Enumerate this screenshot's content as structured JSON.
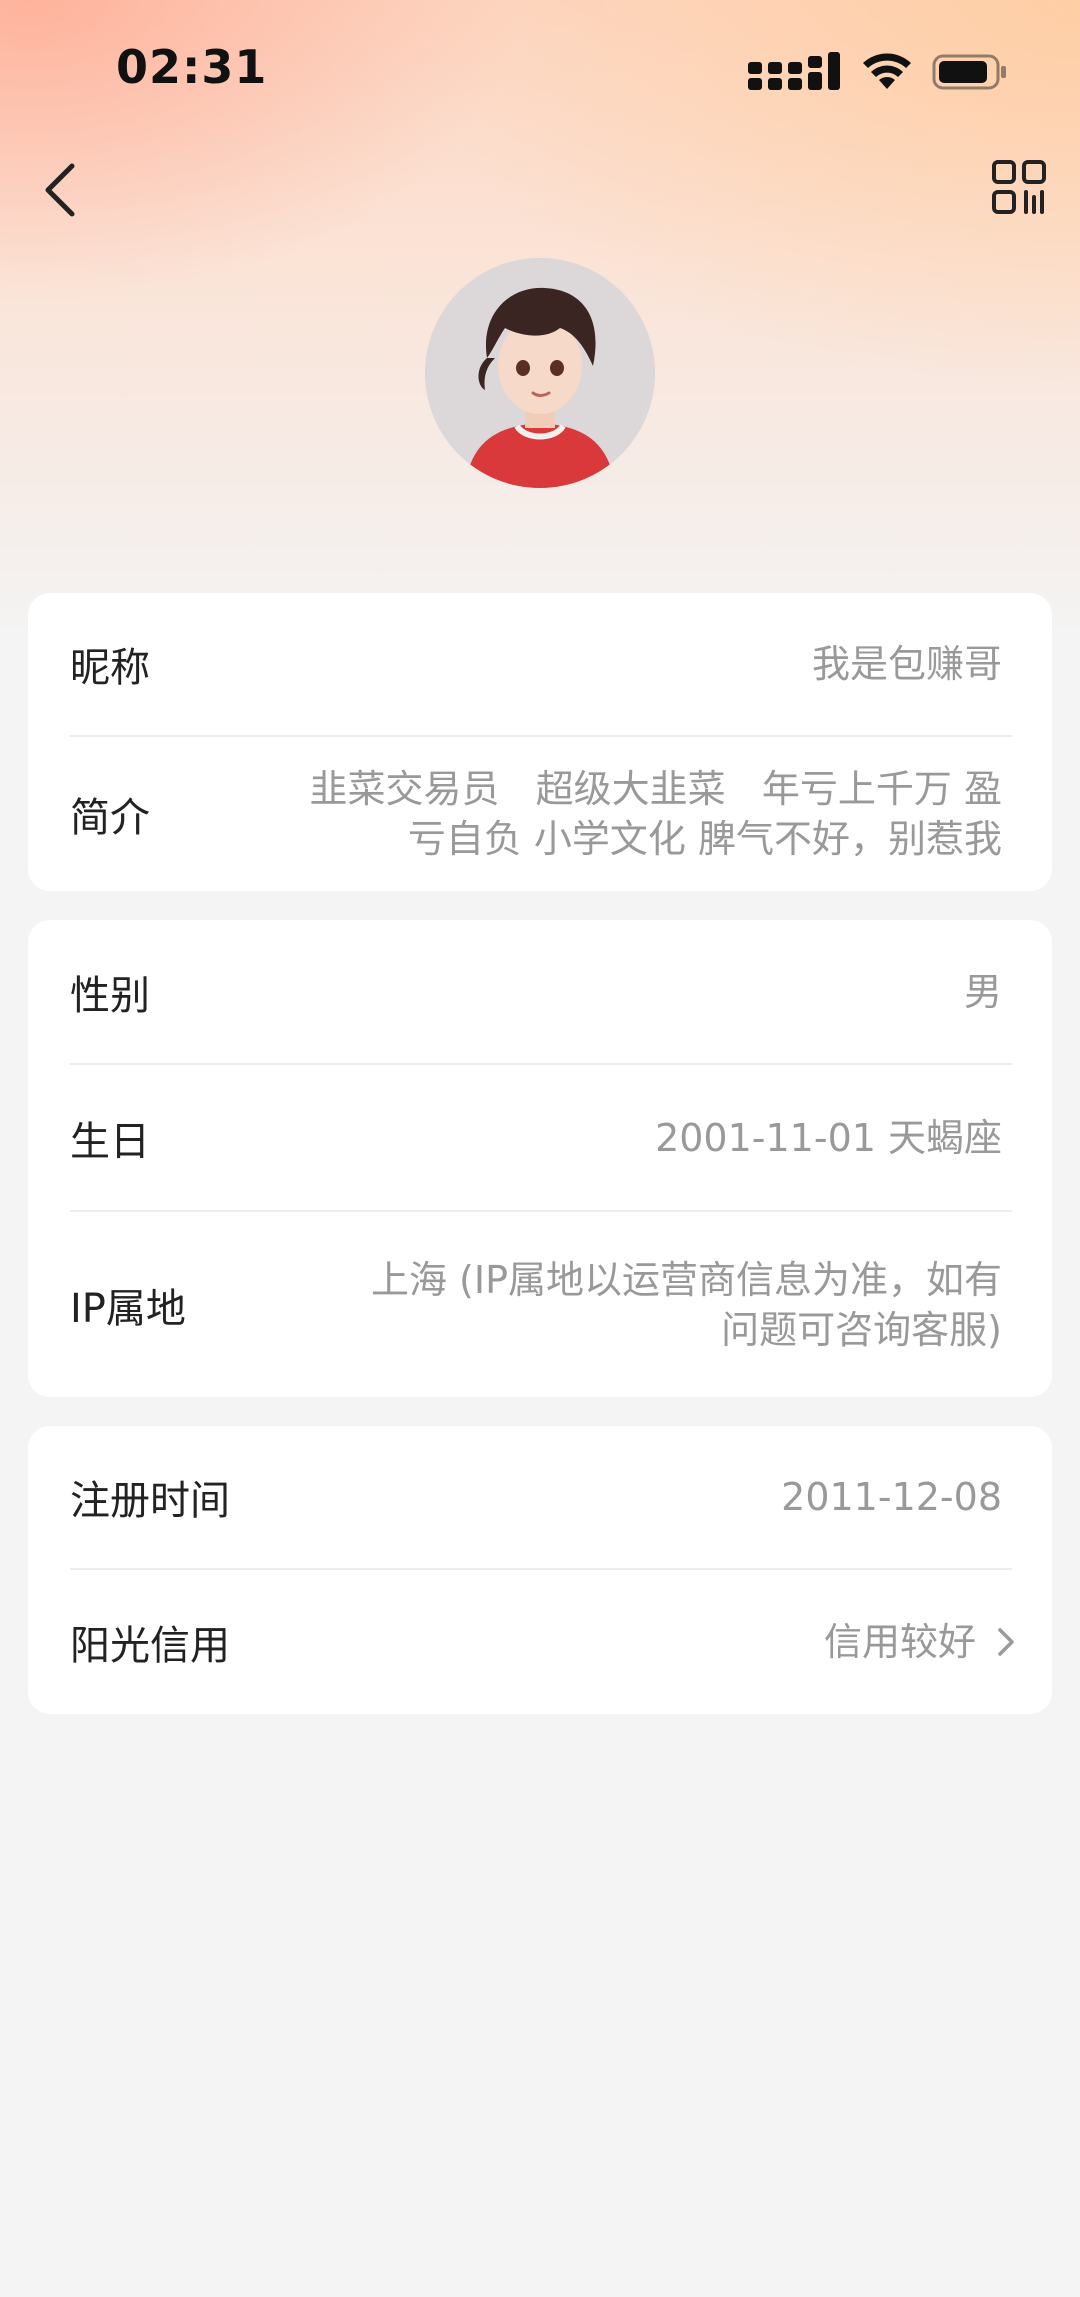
{
  "status_bar": {
    "time": "02:31",
    "icons": [
      "signal-icon",
      "wifi-icon",
      "battery-icon"
    ]
  },
  "nav": {
    "back_icon": "chevron-left-icon",
    "qr_icon": "qr-code-icon"
  },
  "profile": {
    "avatar": "avatar-illustration"
  },
  "section1": {
    "nickname_label": "昵称",
    "nickname_value": "我是包赚哥",
    "bio_label": "简介",
    "bio_value_line1": "韭菜交易员   超级大韭菜   年亏上千万 盈",
    "bio_value_line2": "亏自负 小学文化 脾气不好，别惹我"
  },
  "section2": {
    "gender_label": "性别",
    "gender_value": "男",
    "birthday_label": "生日",
    "birthday_value": "2001-11-01 天蝎座",
    "ip_label": "IP属地",
    "ip_value_line1": "上海 (IP属地以运营商信息为准，如有",
    "ip_value_line2": "问题可咨询客服)"
  },
  "section3": {
    "register_label": "注册时间",
    "register_value": "2011-12-08",
    "credit_label": "阳光信用",
    "credit_value": "信用较好"
  },
  "colors": {
    "label": "#222222",
    "value": "#999999",
    "background": "#f4f4f4",
    "card": "#ffffff",
    "gradient_peach": "#fdd6c2"
  }
}
